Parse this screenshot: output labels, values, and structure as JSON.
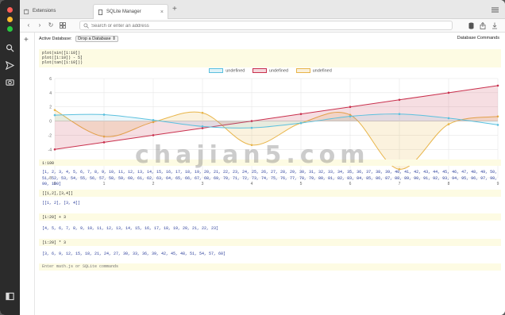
{
  "browser": {
    "tabs": [
      {
        "label": "Extensions"
      },
      {
        "label": "SQLite Manager"
      }
    ],
    "new_tab": "+",
    "address_placeholder": "Search or enter an address"
  },
  "toolbar": {
    "active_db_label": "Active Database:",
    "db_select_value": "Drop a Database ⇕",
    "db_commands_label": "Database Commands"
  },
  "plot_command": {
    "lines": [
      "plot(sin([1:10])",
      "plot([1:10]) - 5]",
      "plot(tan([1:10]))"
    ]
  },
  "chart_data": {
    "type": "line",
    "legend": [
      {
        "label": "undefined",
        "color": "#5bc0de"
      },
      {
        "label": "undefined",
        "color": "#c9304d"
      },
      {
        "label": "undefined",
        "color": "#e8b54a"
      }
    ],
    "x": [
      0,
      1,
      2,
      3,
      4,
      5,
      6,
      7,
      8,
      9
    ],
    "xlim": [
      0,
      9
    ],
    "ylim": [
      -8,
      6
    ],
    "yticks": [
      6,
      4,
      2,
      0,
      -2,
      -4,
      -6,
      -8
    ],
    "grid": true,
    "legend_position": "top",
    "series": [
      {
        "color": "#5bc0de",
        "values": [
          0.84,
          0.91,
          0.14,
          -0.76,
          -0.96,
          -0.28,
          0.66,
          0.99,
          0.41,
          -0.54
        ]
      },
      {
        "color": "#c9304d",
        "values": [
          -4,
          -3,
          -2,
          -1,
          0,
          1,
          2,
          3,
          4,
          5
        ]
      },
      {
        "color": "#e8b54a",
        "values": [
          1.56,
          -2.19,
          -0.14,
          1.16,
          -3.38,
          -0.29,
          0.87,
          -6.8,
          -0.45,
          0.65
        ]
      }
    ]
  },
  "blocks": [
    {
      "command": "1:100",
      "result": "[1, 2, 3, 4, 5, 6, 7, 8, 9, 10, 11, 12, 13, 14, 15, 16, 17, 18, 19, 20, 21, 22, 23, 24, 25, 26, 27, 28, 29, 30, 31, 32, 33, 34, 35, 36, 37, 38, 39, 40, 41, 42, 43, 44, 45, 46, 47, 48, 49, 50, 51, 52, 53, 54, 55, 56, 57, 58, 59, 60, 61, 62, 63, 64, 65, 66, 67, 68, 69, 70, 71, 72, 73, 74, 75, 76, 77, 78, 79, 80, 81, 82, 83, 84, 85, 86, 87, 88, 89, 90, 91, 92, 93, 94, 95, 96, 97, 98, 99, 100]"
    },
    {
      "command": "[[1,2],[3,4]]",
      "result": "[[1, 2], [3, 4]]"
    },
    {
      "command": "[1:20] + 3",
      "result": "[4, 5, 6, 7, 8, 9, 10, 11, 12, 13, 14, 15, 16, 17, 18, 19, 20, 21, 22, 23]"
    },
    {
      "command": "[1:20] * 3",
      "result": "[3, 6, 9, 12, 15, 18, 21, 24, 27, 30, 33, 36, 39, 42, 45, 48, 51, 54, 57, 60]"
    }
  ],
  "input_placeholder": "Enter math.js or SQLite commands",
  "watermark": "chajian5.com"
}
